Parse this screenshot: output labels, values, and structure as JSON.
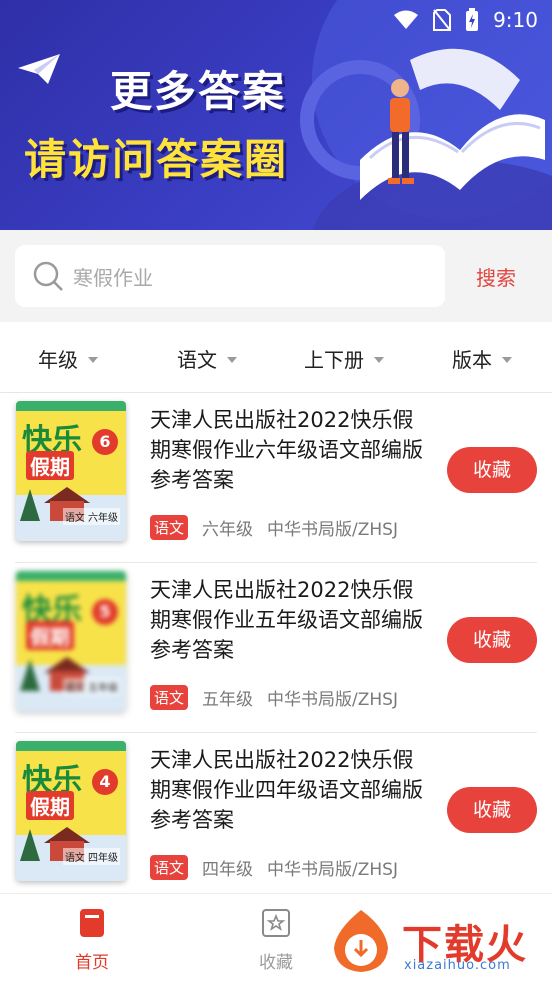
{
  "status_bar": {
    "time": "9:10"
  },
  "banner": {
    "line1": "更多答案",
    "line2": "请访问答案圈"
  },
  "search": {
    "placeholder": "寒假作业",
    "button_label": "搜索"
  },
  "filters": [
    {
      "label": "年级"
    },
    {
      "label": "语文"
    },
    {
      "label": "上下册"
    },
    {
      "label": "版本"
    }
  ],
  "items": [
    {
      "title": "天津人民出版社2022快乐假期寒假作业六年级语文部编版参考答案",
      "subject_tag": "语文",
      "grade": "六年级",
      "publisher": "中华书局版/ZHSJ",
      "fav_label": "收藏",
      "cover": {
        "brand": "快乐",
        "brand2": "假期",
        "number": "6",
        "subject": "语文 六年级"
      }
    },
    {
      "title": "天津人民出版社2022快乐假期寒假作业五年级语文部编版参考答案",
      "subject_tag": "语文",
      "grade": "五年级",
      "publisher": "中华书局版/ZHSJ",
      "fav_label": "收藏",
      "cover": {
        "brand": "快乐",
        "brand2": "假期",
        "number": "5",
        "subject": "语文 五年级"
      }
    },
    {
      "title": "天津人民出版社2022快乐假期寒假作业四年级语文部编版参考答案",
      "subject_tag": "语文",
      "grade": "四年级",
      "publisher": "中华书局版/ZHSJ",
      "fav_label": "收藏",
      "cover": {
        "brand": "快乐",
        "brand2": "假期",
        "number": "4",
        "subject": "语文 四年级"
      }
    }
  ],
  "bottom_nav": [
    {
      "label": "首页",
      "icon": "home-book-icon",
      "active": true
    },
    {
      "label": "收藏",
      "icon": "star-box-icon",
      "active": false
    }
  ],
  "watermark": {
    "text": "下载火",
    "url": "xiazaihuo.com"
  },
  "colors": {
    "accent": "#e8423d",
    "banner": "#3b3fc4",
    "highlight": "#ffe33a"
  }
}
